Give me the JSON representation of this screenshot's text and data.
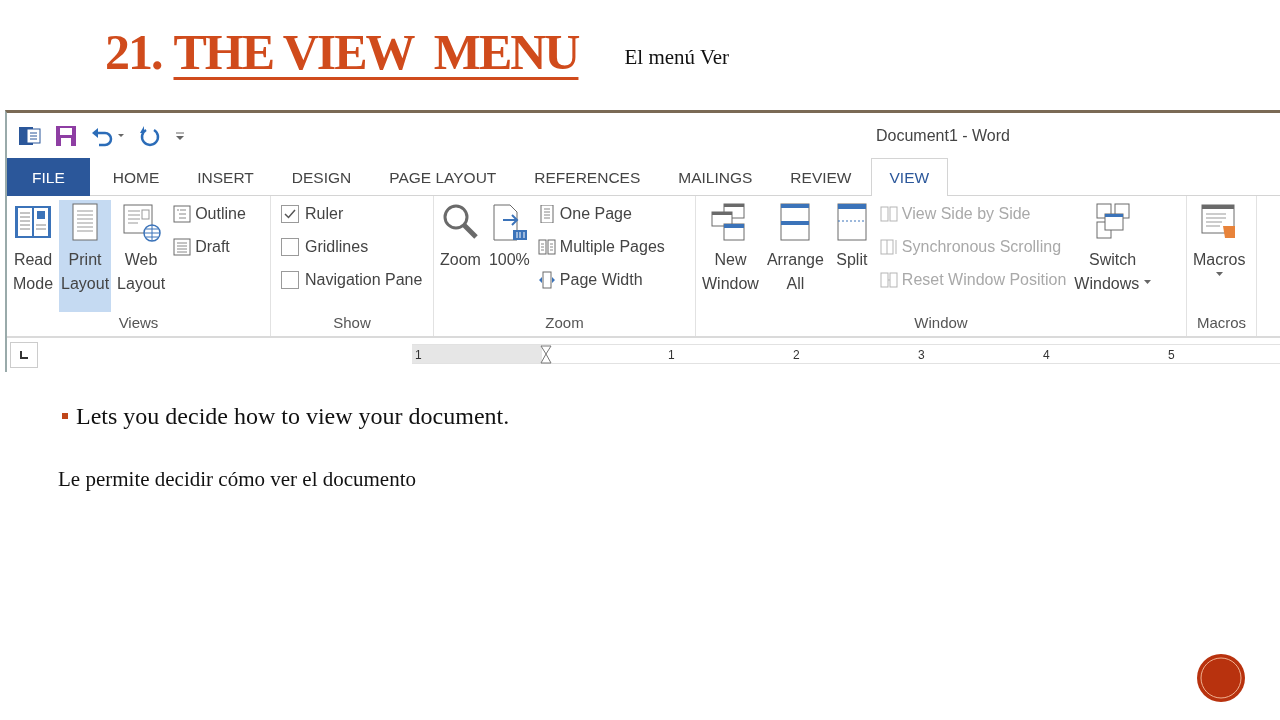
{
  "slide": {
    "title_number": "21.",
    "title": "THE VIEW  MENU",
    "note": "El menú Ver",
    "bullet": "Lets you decide how to view your document.",
    "translation": "Le permite decidir cómo ver el documento"
  },
  "window": {
    "title": "Document1 - Word"
  },
  "tabs": [
    {
      "label": "FILE",
      "kind": "file",
      "selected": false
    },
    {
      "label": "HOME",
      "kind": "tab",
      "selected": false
    },
    {
      "label": "INSERT",
      "kind": "tab",
      "selected": false
    },
    {
      "label": "DESIGN",
      "kind": "tab",
      "selected": false
    },
    {
      "label": "PAGE LAYOUT",
      "kind": "tab",
      "selected": false
    },
    {
      "label": "REFERENCES",
      "kind": "tab",
      "selected": false
    },
    {
      "label": "MAILINGS",
      "kind": "tab",
      "selected": false
    },
    {
      "label": "REVIEW",
      "kind": "tab",
      "selected": false
    },
    {
      "label": "VIEW",
      "kind": "tab",
      "selected": true
    }
  ],
  "ribbon": {
    "groups": [
      {
        "label": "Views",
        "items": [
          {
            "kind": "large",
            "lines": [
              "Read",
              "Mode"
            ],
            "selected": false
          },
          {
            "kind": "large",
            "lines": [
              "Print",
              "Layout"
            ],
            "selected": true
          },
          {
            "kind": "large",
            "lines": [
              "Web",
              "Layout"
            ],
            "selected": false
          },
          {
            "kind": "small",
            "label": "Outline",
            "disabled": false
          },
          {
            "kind": "small",
            "label": "Draft",
            "disabled": false
          }
        ]
      },
      {
        "label": "Show",
        "items": [
          {
            "kind": "check",
            "label": "Ruler",
            "checked": true
          },
          {
            "kind": "check",
            "label": "Gridlines",
            "checked": false
          },
          {
            "kind": "check",
            "label": "Navigation Pane",
            "checked": false
          }
        ]
      },
      {
        "label": "Zoom",
        "items": [
          {
            "kind": "large",
            "lines": [
              "Zoom"
            ],
            "selected": false
          },
          {
            "kind": "large",
            "lines": [
              "100%"
            ],
            "selected": false
          },
          {
            "kind": "small",
            "label": "One Page",
            "disabled": false
          },
          {
            "kind": "small",
            "label": "Multiple Pages",
            "disabled": false
          },
          {
            "kind": "small",
            "label": "Page Width",
            "disabled": false
          }
        ]
      },
      {
        "label": "Window",
        "items": [
          {
            "kind": "large",
            "lines": [
              "New",
              "Window"
            ],
            "selected": false
          },
          {
            "kind": "large",
            "lines": [
              "Arrange",
              "All"
            ],
            "selected": false
          },
          {
            "kind": "large",
            "lines": [
              "Split"
            ],
            "selected": false
          },
          {
            "kind": "small",
            "label": "View Side by Side",
            "disabled": true
          },
          {
            "kind": "small",
            "label": "Synchronous Scrolling",
            "disabled": true
          },
          {
            "kind": "small",
            "label": "Reset Window Position",
            "disabled": true
          },
          {
            "kind": "large",
            "lines": [
              "Switch",
              "Windows"
            ],
            "selected": false,
            "dropdown": true
          }
        ]
      },
      {
        "label": "Macros",
        "items": [
          {
            "kind": "large",
            "lines": [
              "Macros"
            ],
            "selected": false,
            "dropdown": true
          }
        ]
      }
    ]
  },
  "ruler": {
    "labels": [
      "1",
      "1",
      "2",
      "3",
      "4",
      "5"
    ]
  }
}
